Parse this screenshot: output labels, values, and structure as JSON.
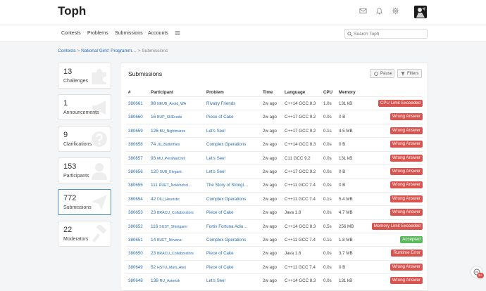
{
  "app": {
    "title": "Toph"
  },
  "colors": {
    "link": "#2a6cb0",
    "danger": "#d9534f",
    "success": "#5cb85c",
    "active_border": "#4a90c4"
  },
  "topbar_icons": [
    "mail-icon",
    "bell-icon",
    "gear-icon"
  ],
  "nav": {
    "items": [
      "Contests",
      "Problems",
      "Submissions",
      "Accounts"
    ],
    "search_placeholder": "Search Toph"
  },
  "breadcrumb": {
    "root": "Contests",
    "sep": ">",
    "contest": "National Girls' Programm…",
    "current": "Submissions"
  },
  "stats": [
    {
      "value": "13",
      "label": "Challenges",
      "icon": "puzzle-icon"
    },
    {
      "value": "1",
      "label": "Announcements",
      "icon": "megaphone-icon"
    },
    {
      "value": "9",
      "label": "Clarifications",
      "icon": "question-icon"
    },
    {
      "value": "153",
      "label": "Participants",
      "icon": "user-icon"
    },
    {
      "value": "772",
      "label": "Submissions",
      "icon": "send-icon",
      "active": true
    },
    {
      "value": "22",
      "label": "Moderators",
      "icon": "gavel-icon"
    }
  ],
  "submissions": {
    "title": "Submissions",
    "pause_label": "Pause",
    "filters_label": "Filters",
    "columns": [
      "#",
      "Participant",
      "Problem",
      "Time",
      "Language",
      "CPU",
      "Memory"
    ],
    "rows": [
      {
        "id": "380661",
        "rank": "98",
        "user": "NEUB_Avoid_WA",
        "problem": "Rivalry Friends",
        "time": "2w ago",
        "lang": "C++14 GCC 8.3",
        "cpu": "1.0s",
        "mem": "131 kB",
        "verdict": "CPU Limit Exceeded",
        "ok": false
      },
      {
        "id": "380660",
        "rank": "16",
        "user": "BUP_SHEcode",
        "problem": "Piece of Cake",
        "time": "2w ago",
        "lang": "C++17 GCC 9.2",
        "cpu": "0.0s",
        "mem": "0 B",
        "verdict": "Wrong Answer",
        "ok": false
      },
      {
        "id": "380659",
        "rank": "126",
        "user": "BU_Nightmares",
        "problem": "Let's See!",
        "time": "2w ago",
        "lang": "C++17 GCC 9.2",
        "cpu": "0.1s",
        "mem": "4.5 MB",
        "verdict": "Wrong Answer",
        "ok": false
      },
      {
        "id": "380658",
        "rank": "74",
        "user": "JU_Butterflies",
        "problem": "Complex Operations",
        "time": "2w ago",
        "lang": "C++14 GCC 8.3",
        "cpu": "0.0s",
        "mem": "0 B",
        "verdict": "Wrong Answer",
        "ok": false
      },
      {
        "id": "380657",
        "rank": "93",
        "user": "MU_PeraNaiChill",
        "problem": "Let's See!",
        "time": "2w ago",
        "lang": "C11 GCC 9.2",
        "cpu": "0.0s",
        "mem": "131 kB",
        "verdict": "Wrong Answer",
        "ok": false
      },
      {
        "id": "380656",
        "rank": "120",
        "user": "SUB_Elegant",
        "problem": "Let's See!",
        "time": "2w ago",
        "lang": "C++17 GCC 9.2",
        "cpu": "0.0s",
        "mem": "0 B",
        "verdict": "Wrong Answer",
        "ok": false
      },
      {
        "id": "380655",
        "rank": "111",
        "user": "RUET_Nokkhotrol…",
        "problem": "The Story of Stringl…",
        "time": "2w ago",
        "lang": "C++11 GCC 7.4",
        "cpu": "0.0s",
        "mem": "0 B",
        "verdict": "Wrong Answer",
        "ok": false
      },
      {
        "id": "380654",
        "rank": "42",
        "user": "DIU_Heuristic",
        "problem": "Complex Operations",
        "time": "2w ago",
        "lang": "C++11 GCC 7.4",
        "cpu": "0.1s",
        "mem": "5.4 MB",
        "verdict": "Wrong Answer",
        "ok": false
      },
      {
        "id": "380653",
        "rank": "23",
        "user": "BRACU_Collaborators",
        "problem": "Piece of Cake",
        "time": "2w ago",
        "lang": "Java 1.8",
        "cpu": "0.0s",
        "mem": "4.7 MB",
        "verdict": "Wrong Answer",
        "ok": false
      },
      {
        "id": "380652",
        "rank": "116",
        "user": "SUST_Shinigami",
        "problem": "Fortis Fortuna Adiu…",
        "time": "2w ago",
        "lang": "C++14 GCC 8.3",
        "cpu": "0.5s",
        "mem": "256 MB",
        "verdict": "Memory Limit Exceeded",
        "ok": false
      },
      {
        "id": "380651",
        "rank": "14",
        "user": "BUET_Nirvana",
        "problem": "Complex Operations",
        "time": "2w ago",
        "lang": "C++11 GCC 7.4",
        "cpu": "0.1s",
        "mem": "1.8 MB",
        "verdict": "Accepted",
        "ok": true
      },
      {
        "id": "380650",
        "rank": "23",
        "user": "BRACU_Collaborators",
        "problem": "Piece of Cake",
        "time": "2w ago",
        "lang": "Java 1.8",
        "cpu": "0.0s",
        "mem": "3.7 MB",
        "verdict": "Runtime Error",
        "ok": false
      },
      {
        "id": "380649",
        "rank": "52",
        "user": "HSTU_Mavi_Ates",
        "problem": "Piece of Cake",
        "time": "2w ago",
        "lang": "C++11 GCC 7.4",
        "cpu": "0.0s",
        "mem": "0 B",
        "verdict": "Wrong Answer",
        "ok": false
      },
      {
        "id": "380648",
        "rank": "138",
        "user": "RU_Asterisk",
        "problem": "Let's See!",
        "time": "2w ago",
        "lang": "C++14 GCC 8.3",
        "cpu": "0.0s",
        "mem": "131 kB",
        "verdict": "Wrong Answer",
        "ok": false
      }
    ]
  },
  "chat": {
    "badge": "9+"
  }
}
